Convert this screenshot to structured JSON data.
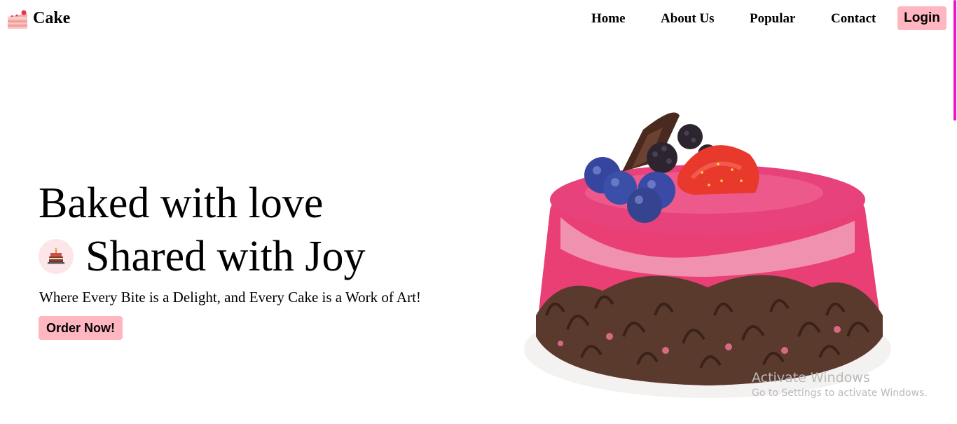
{
  "brand": {
    "name": "Cake",
    "icon": "cake-slice-icon"
  },
  "nav": {
    "links": [
      "Home",
      "About Us",
      "Popular",
      "Contact"
    ],
    "login_label": "Login"
  },
  "hero": {
    "line1": "Baked with love",
    "line2": "Shared with Joy",
    "badge_icon": "cake-icon",
    "tagline": "Where Every Bite is a Delight, and Every Cake is a Work of Art!",
    "cta_label": "Order Now!"
  },
  "hero_image": {
    "alt": "cake-illustration"
  },
  "watermark": {
    "title": "Activate Windows",
    "subtitle": "Go to Settings to activate Windows."
  },
  "colors": {
    "button_bg": "#ffb6c1",
    "badge_bg": "#fde6ea",
    "scrollbar": "#e815c9",
    "text": "#000000"
  }
}
